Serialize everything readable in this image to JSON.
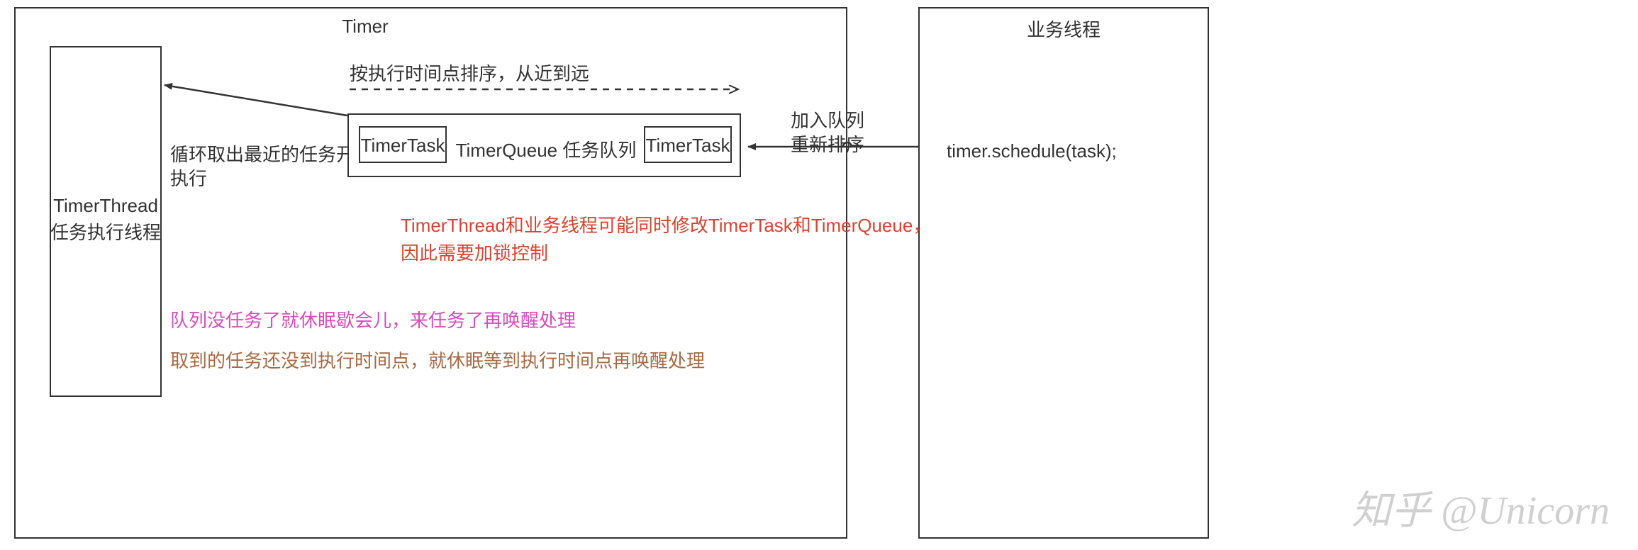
{
  "timer_box": {
    "title": "Timer"
  },
  "business_thread_box": {
    "title": "业务线程",
    "code": "timer.schedule(task);"
  },
  "timer_thread_box": {
    "line1": "TimerThread",
    "line2": "任务执行线程"
  },
  "sort_note": "按执行时间点排序，从近到远",
  "loop_note": {
    "line1": "循环取出最近的任务开始",
    "line2": "执行"
  },
  "queue": {
    "title": "TimerQueue 任务队列",
    "task_left": "TimerTask",
    "task_right": "TimerTask"
  },
  "add_note": {
    "line1": "加入队列",
    "line2": "重新排序"
  },
  "lock_note": {
    "line1": "TimerThread和业务线程可能同时修改TimerTask和TimerQueue，",
    "line2": "因此需要加锁控制"
  },
  "sleep_note": "队列没任务了就休眠歇会儿，来任务了再唤醒处理",
  "wait_note": "取到的任务还没到执行时间点，就休眠等到执行时间点再唤醒处理",
  "watermark": "知乎 @Unicorn"
}
